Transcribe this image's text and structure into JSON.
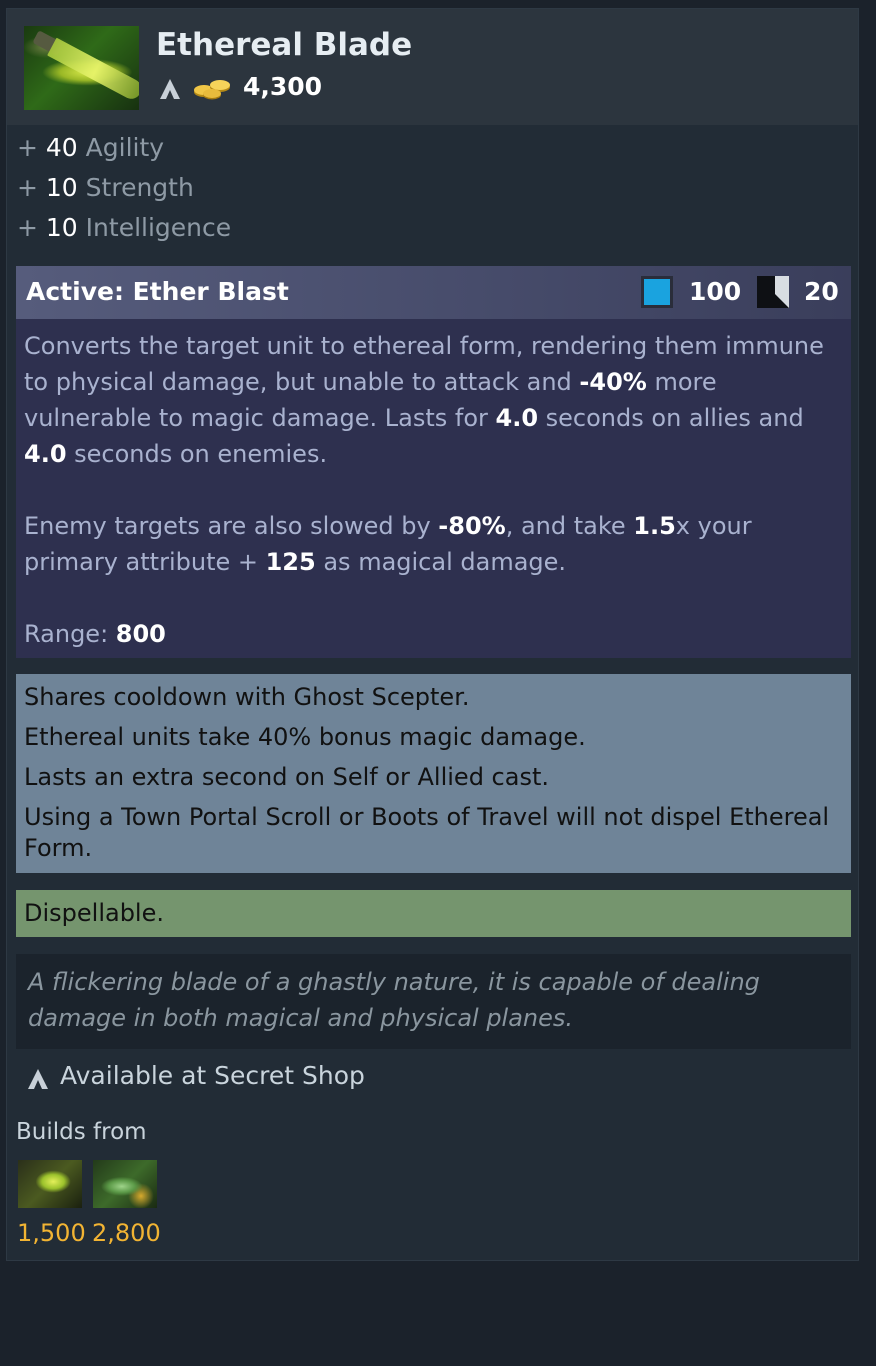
{
  "item": {
    "name": "Ethereal Blade",
    "cost": "4,300",
    "icons": {
      "shop": "secret-shop-tent-icon",
      "gold": "gold-coins-icon"
    }
  },
  "attributes": [
    {
      "plus": "+",
      "value": "40",
      "name": "Agility"
    },
    {
      "plus": "+",
      "value": "10",
      "name": "Strength"
    },
    {
      "plus": "+",
      "value": "10",
      "name": "Intelligence"
    }
  ],
  "active": {
    "title": "Active: Ether Blast",
    "mana_cost": "100",
    "cooldown": "20",
    "desc1": {
      "t1": "Converts the target unit to ethereal form, rendering them immune to physical damage, but unable to attack and ",
      "b1": "-40%",
      "t2": " more vulnerable to magic damage. Lasts for ",
      "b2": "4.0",
      "t3": " seconds on allies and ",
      "b3": "4.0",
      "t4": " seconds on enemies."
    },
    "desc2": {
      "t1": "Enemy targets are also slowed by ",
      "b1": "-80%",
      "t2": ", and take ",
      "b2": "1.5",
      "t3": "x your primary attribute + ",
      "b3": "125",
      "t4": " as magical damage."
    },
    "range_label": "Range: ",
    "range_value": "800"
  },
  "notes": [
    "Shares cooldown with Ghost Scepter.",
    "Ethereal units take 40% bonus magic damage.",
    "Lasts an extra second on Self or Allied cast.",
    "Using a Town Portal Scroll or Boots of Travel will not dispel Ethereal Form."
  ],
  "dispel": "Dispellable.",
  "lore": "A flickering blade of a ghastly nature, it is capable of dealing damage in both magical and physical planes.",
  "shop_availability": "Available at Secret Shop",
  "builds": {
    "label": "Builds from",
    "components": [
      {
        "icon": "ghost-scepter-icon",
        "cost": "1,500"
      },
      {
        "icon": "eaglesong-icon",
        "cost": "2,800"
      }
    ]
  },
  "colors": {
    "mana": "#1aa3df",
    "component_cost": "#f2b433",
    "notes_bg": "#6f8498",
    "dispel_bg": "#75956e",
    "active_bg": "#2e304f"
  }
}
